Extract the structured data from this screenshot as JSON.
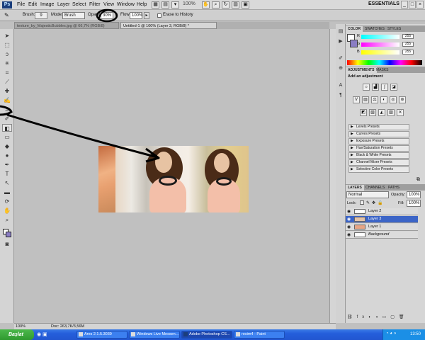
{
  "app": {
    "logo": "Ps"
  },
  "menu": [
    "File",
    "Edit",
    "Image",
    "Layer",
    "Select",
    "Filter",
    "View",
    "Window",
    "Help"
  ],
  "zoom": "100%",
  "workspace": "ESSENTIALS",
  "options": {
    "brush_label": "Brush:",
    "brush_size": "9",
    "mode_label": "Mode:",
    "mode_value": "Brush",
    "opacity_label": "Opacity:",
    "opacity_value": "30%",
    "flow_label": "Flow:",
    "flow_value": "100%",
    "erase_history": "Erase to History"
  },
  "doc_tabs": [
    {
      "label": "texture_by_MajesticBubbles.jpg @ 66,7% (RGB/8)",
      "active": false
    },
    {
      "label": "Untitled-1 @ 100% (Layer 3, RGB/8) *",
      "active": true
    }
  ],
  "status": {
    "zoom": "100%",
    "doc": "Doc: 263,7K/3,56M"
  },
  "color_panel": {
    "tabs": [
      "COLOR",
      "SWATCHES",
      "STYLES"
    ],
    "channels": [
      {
        "label": "R",
        "value": "255"
      },
      {
        "label": "G",
        "value": "255"
      },
      {
        "label": "B",
        "value": "255"
      }
    ]
  },
  "adjustments": {
    "tabs": [
      "ADJUSTMENTS",
      "MASKS"
    ],
    "heading": "Add an adjustment",
    "presets": [
      "Levels Presets",
      "Curves Presets",
      "Exposure Presets",
      "Hue/Saturation Presets",
      "Black & White Presets",
      "Channel Mixer Presets",
      "Selective Color Presets"
    ]
  },
  "layers": {
    "tabs": [
      "LAYERS",
      "CHANNELS",
      "PATHS"
    ],
    "blend_mode": "Normal",
    "opacity_label": "Opacity:",
    "opacity_value": "100%",
    "lock_label": "Lock:",
    "fill_label": "Fill:",
    "fill_value": "100%",
    "items": [
      {
        "name": "Layer 2",
        "selected": false
      },
      {
        "name": "Layer 3",
        "selected": true
      },
      {
        "name": "Layer 1",
        "selected": false
      },
      {
        "name": "Background",
        "selected": false
      }
    ]
  },
  "taskbar": {
    "start": "Başlat",
    "buttons": [
      {
        "label": "Ares 2.1.5.3039",
        "active": false
      },
      {
        "label": "Windows Live Messen...",
        "active": false
      },
      {
        "label": "Adobe Photoshop CS...",
        "active": true
      },
      {
        "label": "resim4 - Paint",
        "active": false
      }
    ],
    "clock": "13:50"
  }
}
